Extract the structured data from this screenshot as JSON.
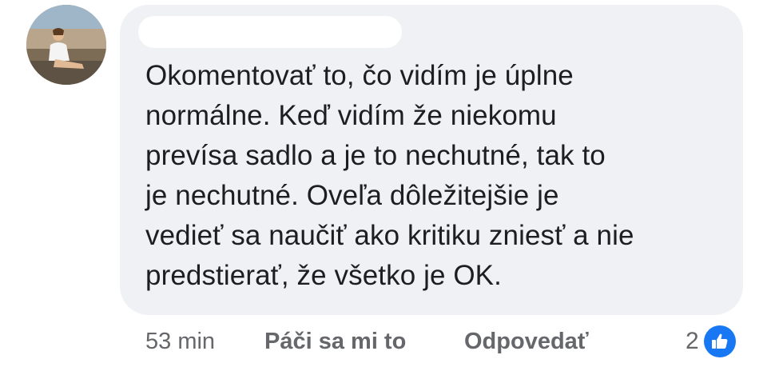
{
  "comment": {
    "author_avatar_icon": "profile-photo",
    "author_name_redacted": true,
    "text_lines": [
      "Okomentovať to, čo vidím je úplne",
      "normálne. Keď vidím že niekomu",
      "prevísa sadlo a je to nechutné, tak to",
      "je nechutné. Oveľa dôležitejšie je",
      "vedieť sa naučiť ako kritiku zniesť a nie",
      "predstierať, že všetko je OK."
    ]
  },
  "actions": {
    "timestamp": "53 min",
    "like_label": "Páči sa mi to",
    "reply_label": "Odpovedať"
  },
  "reactions": {
    "count": "2",
    "icon": "thumbs-up-icon",
    "color": "#1877f2"
  },
  "colors": {
    "bubble": "#eff1f5",
    "text": "#1c1e21",
    "meta": "#65676b"
  }
}
